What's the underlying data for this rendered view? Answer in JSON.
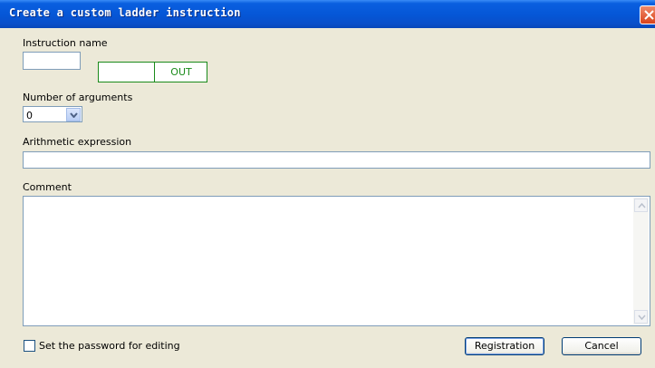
{
  "window": {
    "title": "Create a custom ladder instruction"
  },
  "form": {
    "instruction_name_label": "Instruction name",
    "instruction_name_value": "",
    "out_label": "OUT",
    "arguments_label": "Number of arguments",
    "arguments_value": "0",
    "expression_label": "Arithmetic expression",
    "expression_value": "",
    "comment_label": "Comment",
    "comment_value": "",
    "password_label": "Set the password for editing",
    "password_checked": false
  },
  "buttons": {
    "registration": "Registration",
    "cancel": "Cancel"
  },
  "colors": {
    "title_bar": "#0556d6",
    "ladder_green": "#1a8a1a",
    "window_bg": "#ece9d8"
  },
  "icons": [
    "close-icon",
    "chevron-down-icon",
    "scroll-up-icon",
    "scroll-down-icon"
  ]
}
